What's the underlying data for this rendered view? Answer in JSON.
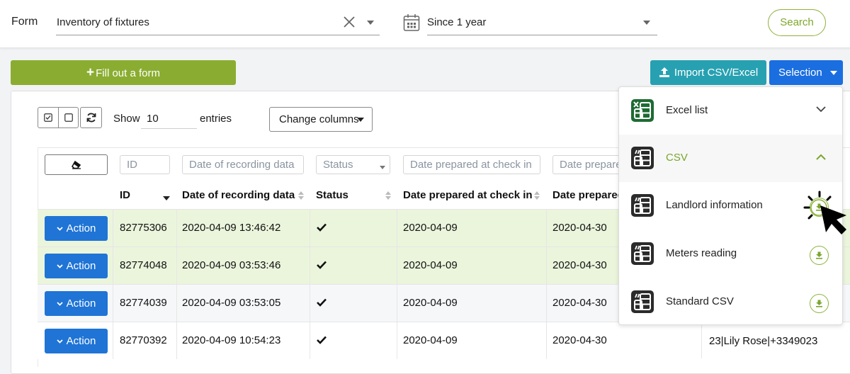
{
  "topbar": {
    "form_label": "Form",
    "form_value": "Inventory of fixtures",
    "period_value": "Since 1 year",
    "search_label": "Search"
  },
  "toolbar": {
    "fill_label": "Fill out a form",
    "import_label": "Import CSV/Excel",
    "selection_label": "Selection",
    "show_label": "Show",
    "entries_value": "10",
    "entries_label": "entries",
    "change_columns_label": "Change columns"
  },
  "table": {
    "filters": {
      "id": "ID",
      "date_recording": "Date of recording data",
      "status": "Status",
      "date_checkin": "Date prepared at check in",
      "date_checkout": "Date prepare"
    },
    "headers": {
      "id": "ID",
      "date_recording": "Date of recording data",
      "status": "Status",
      "date_checkin": "Date prepared at check in",
      "date_checkout": "Date prepared"
    },
    "action_label": "Action",
    "rows": [
      {
        "id": "82775306",
        "date_recording": "2020-04-09 13:46:42",
        "status": "done",
        "date_checkin": "2020-04-09",
        "date_checkout": "2020-04-30",
        "selected": true
      },
      {
        "id": "82774048",
        "date_recording": "2020-04-09 03:53:46",
        "status": "done",
        "date_checkin": "2020-04-09",
        "date_checkout": "2020-04-30",
        "selected": true
      },
      {
        "id": "82774039",
        "date_recording": "2020-04-09 03:53:05",
        "status": "done",
        "date_checkin": "2020-04-09",
        "date_checkout": "2020-04-30",
        "selected": false
      },
      {
        "id": "82770392",
        "date_recording": "2020-04-09 10:54:23",
        "status": "done",
        "date_checkin": "2020-04-09",
        "date_checkout": "2020-04-30",
        "selected": false,
        "extra": "23|Lily Rose|+3349023"
      }
    ]
  },
  "dropdown": {
    "items": [
      {
        "label": "Excel list",
        "icon": "excel-icon",
        "state": "collapsed"
      },
      {
        "label": "CSV",
        "icon": "csv-icon",
        "state": "expanded"
      },
      {
        "label": "Landlord information",
        "icon": "csv-icon",
        "action": "download"
      },
      {
        "label": "Meters reading",
        "icon": "csv-icon",
        "action": "download"
      },
      {
        "label": "Standard CSV",
        "icon": "csv-icon",
        "action": "download"
      }
    ]
  },
  "colors": {
    "brand_green": "#8aad31",
    "import_teal": "#27a1b1",
    "primary_blue": "#1a6ee0",
    "selected_row": "#ebf5dc"
  }
}
